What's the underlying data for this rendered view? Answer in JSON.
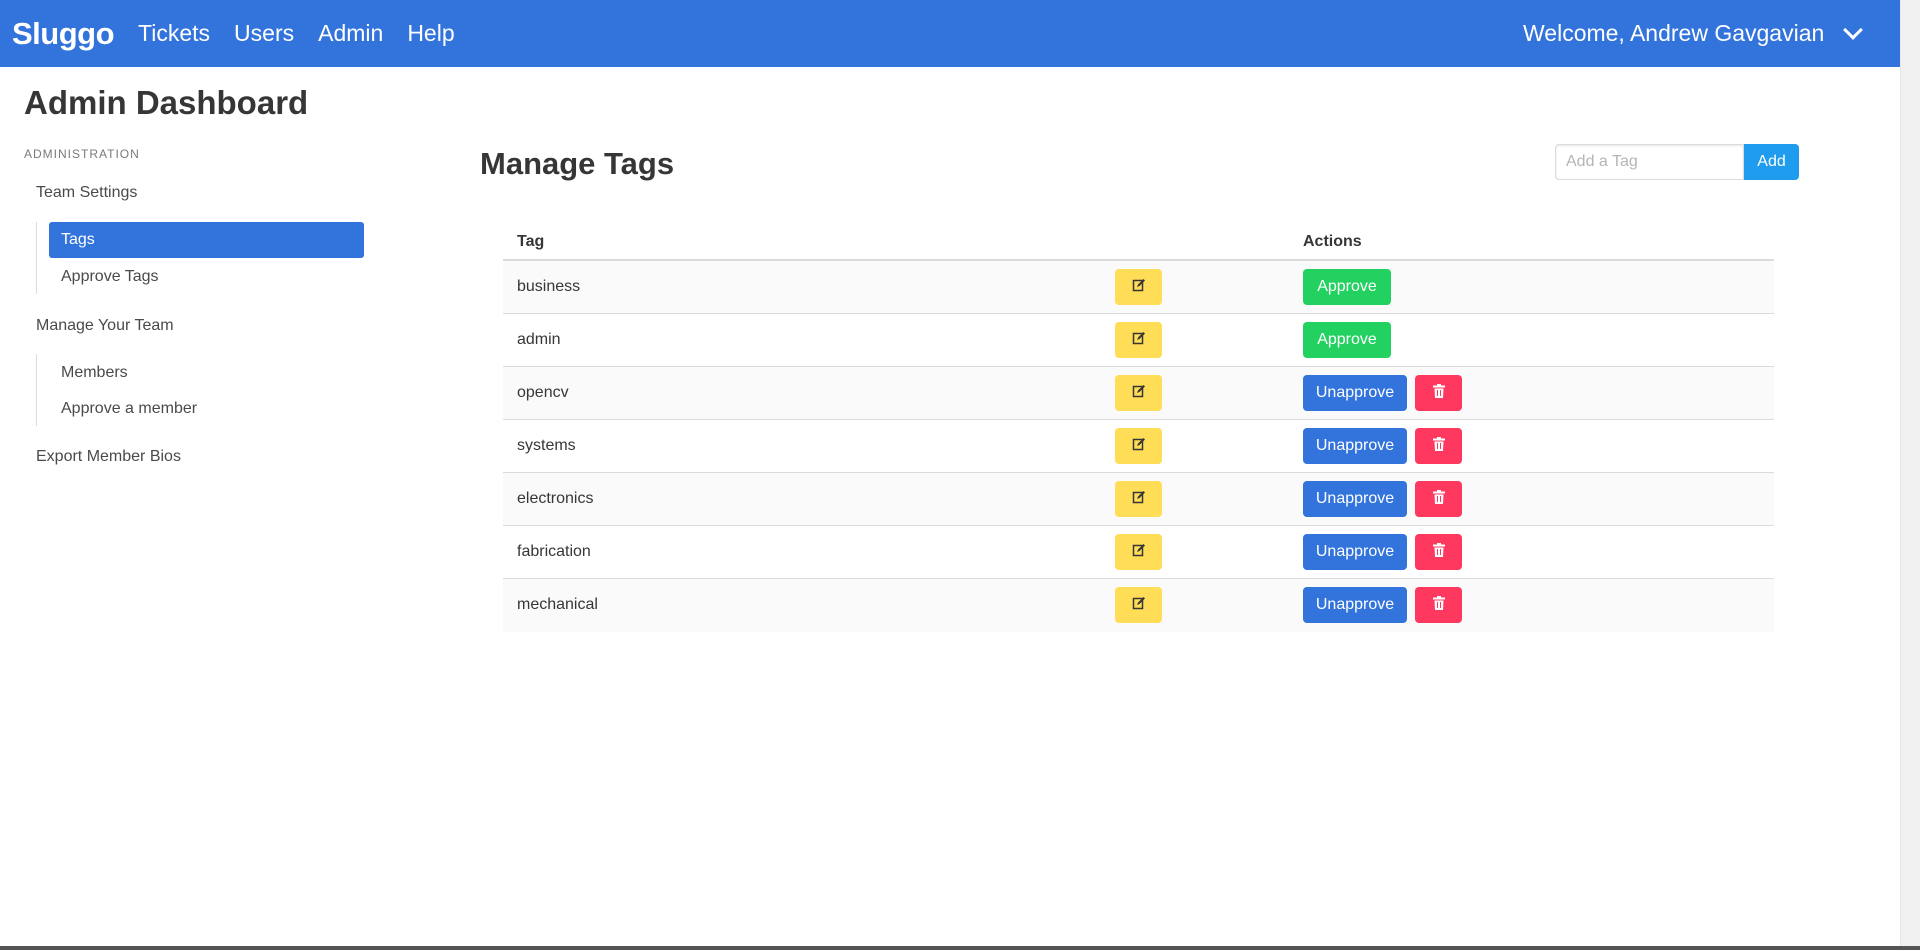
{
  "navbar": {
    "brand": "Sluggo",
    "items": [
      "Tickets",
      "Users",
      "Admin",
      "Help"
    ],
    "welcome": "Welcome, Andrew Gavgavian"
  },
  "sidebar": {
    "title": "Admin Dashboard",
    "label": "Administration",
    "team_settings": "Team Settings",
    "tags": "Tags",
    "approve_tags": "Approve Tags",
    "manage_team": "Manage Your Team",
    "members": "Members",
    "approve_member": "Approve a member",
    "export": "Export Member Bios"
  },
  "main": {
    "title": "Manage Tags",
    "add_placeholder": "Add a Tag",
    "add_label": "Add",
    "columns": {
      "tag": "Tag",
      "actions": "Actions"
    },
    "rows": [
      {
        "tag": "business",
        "action": "Approve",
        "deletable": false
      },
      {
        "tag": "admin",
        "action": "Approve",
        "deletable": false
      },
      {
        "tag": "opencv",
        "action": "Unapprove",
        "deletable": true
      },
      {
        "tag": "systems",
        "action": "Unapprove",
        "deletable": true
      },
      {
        "tag": "electronics",
        "action": "Unapprove",
        "deletable": true
      },
      {
        "tag": "fabrication",
        "action": "Unapprove",
        "deletable": true
      },
      {
        "tag": "mechanical",
        "action": "Unapprove",
        "deletable": true
      }
    ]
  },
  "colors": {
    "primary": "#3273dc",
    "success": "#23d160",
    "warning": "#ffdd57",
    "danger": "#ff3860",
    "info": "#209cee"
  }
}
